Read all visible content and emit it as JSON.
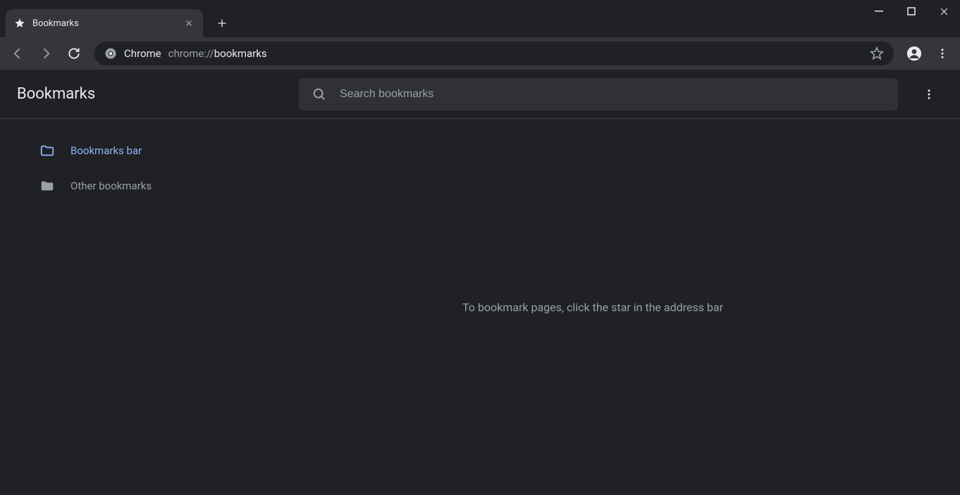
{
  "tab": {
    "title": "Bookmarks"
  },
  "omnibox": {
    "scheme_label": "Chrome",
    "url_gray": "chrome://",
    "url_white": "bookmarks"
  },
  "page": {
    "title": "Bookmarks",
    "search_placeholder": "Search bookmarks",
    "empty_message": "To bookmark pages, click the star in the address bar"
  },
  "sidebar": {
    "items": [
      {
        "label": "Bookmarks bar",
        "active": true
      },
      {
        "label": "Other bookmarks",
        "active": false
      }
    ]
  }
}
